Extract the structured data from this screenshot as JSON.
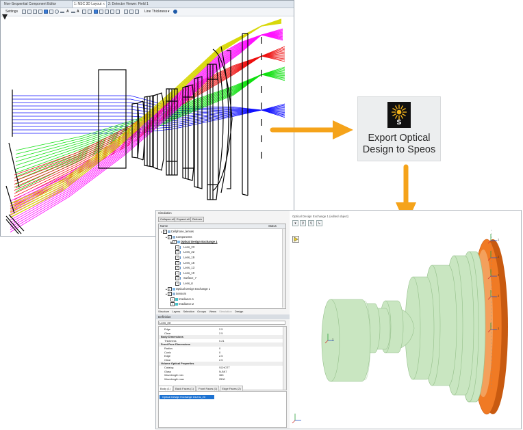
{
  "zemax": {
    "tabs": [
      {
        "label": "Non-Sequential Component Editor",
        "active": false
      },
      {
        "label": "1: NSC 3D Layout",
        "active": true,
        "close": "x"
      },
      {
        "label": "2: Detector Viewer: Field 1",
        "active": false
      }
    ],
    "toolbar": {
      "settings_label": "Settings",
      "line_thickness_label": "Line Thickness"
    },
    "ray_colors": {
      "blue": "#1010ff",
      "green": "#10e010",
      "red": "#ee1010",
      "magenta": "#ff10ff",
      "yellow": "#d8d80a"
    }
  },
  "export_button": {
    "line1": "Export Optical",
    "line2": "Design to Speos",
    "logo_letter": "S",
    "icon": "speos-sun-logo-icon"
  },
  "arrow_color": "#f5a31a",
  "speos": {
    "panel_title": "Simulation",
    "buttons": {
      "collapse": "Collapse all",
      "expand": "Expand all",
      "refresh": "Refresh"
    },
    "tree_header": {
      "name": "Name",
      "status": "Status"
    },
    "tree": [
      {
        "label": "Cellphone_lenses",
        "indent": 0,
        "icon": "folder",
        "bold": false
      },
      {
        "label": "Components",
        "indent": 1,
        "icon": "folder",
        "bold": false
      },
      {
        "label": "Optical Design Exchange 1",
        "indent": 2,
        "icon": "ode",
        "bold": true
      },
      {
        "label": "Lens_23",
        "indent": 3,
        "icon": "lens",
        "bold": false
      },
      {
        "label": "Lens_22",
        "indent": 3,
        "icon": "lens",
        "bold": false
      },
      {
        "label": "Lens_19",
        "indent": 3,
        "icon": "lens",
        "bold": false
      },
      {
        "label": "Lens_16",
        "indent": 3,
        "icon": "lens",
        "bold": false
      },
      {
        "label": "Lens_13",
        "indent": 3,
        "icon": "lens",
        "bold": false
      },
      {
        "label": "Lens_10",
        "indent": 3,
        "icon": "lens",
        "bold": false
      },
      {
        "label": "Surface_7",
        "indent": 3,
        "icon": "lens",
        "bold": false
      },
      {
        "label": "Lens_6",
        "indent": 3,
        "icon": "lens",
        "bold": false
      },
      {
        "label": "Optical Design Exchange 1",
        "indent": 1,
        "icon": "ode",
        "bold": false
      },
      {
        "label": "Sensors",
        "indent": 1,
        "icon": "folder",
        "bold": false
      },
      {
        "label": "Irradiance.1",
        "indent": 2,
        "icon": "sensor",
        "bold": false
      },
      {
        "label": "Irradiance.2",
        "indent": 2,
        "icon": "sensor",
        "bold": false
      }
    ],
    "panel_tabs": [
      "Structure",
      "Layers",
      "Selection",
      "Groups",
      "Views",
      "Simulation",
      "Design"
    ],
    "definition_title": "Definition",
    "definition_name": "Lens_23",
    "properties": [
      {
        "key": "Edge",
        "value": "2.5",
        "cat": false
      },
      {
        "key": "Clear",
        "value": "2.5",
        "cat": false
      },
      {
        "key": "Body Dimensions",
        "value": "",
        "cat": true
      },
      {
        "key": "Thickness",
        "value": "0.21",
        "cat": false
      },
      {
        "key": "Front Face Dimensions",
        "value": "",
        "cat": true
      },
      {
        "key": "Radius",
        "value": "0",
        "cat": false
      },
      {
        "key": "Conic",
        "value": "0",
        "cat": false
      },
      {
        "key": "Edge",
        "value": "2.5",
        "cat": false
      },
      {
        "key": "Clear",
        "value": "2.5",
        "cat": false
      },
      {
        "key": "Volume Optical Properties",
        "value": "",
        "cat": true
      },
      {
        "key": "Catalog",
        "value": "SCHOTT",
        "cat": false
      },
      {
        "key": "Glass",
        "value": "N-BK7",
        "cat": false
      },
      {
        "key": "Wavelength min",
        "value": "365",
        "cat": false
      },
      {
        "key": "Wavelength max",
        "value": "2500",
        "cat": false
      }
    ],
    "body_tabs": [
      {
        "label": "Body (1)",
        "active": true
      },
      {
        "label": "Back Faces (1)",
        "active": false
      },
      {
        "label": "Front Faces (1)",
        "active": false
      },
      {
        "label": "Edge Faces (2)",
        "active": false
      }
    ],
    "body_selected": "Optical Design Exchange 1/Lens_23",
    "viewport_title": "Optical Design Exchange 1 (edited object)",
    "axis_label": "Z",
    "colors": {
      "lens": "#c9e6c1",
      "lens_dark": "#95c08b",
      "sensor": "#f07a24",
      "sensor_dark": "#c85a10",
      "selection": "#1e73d2"
    }
  }
}
